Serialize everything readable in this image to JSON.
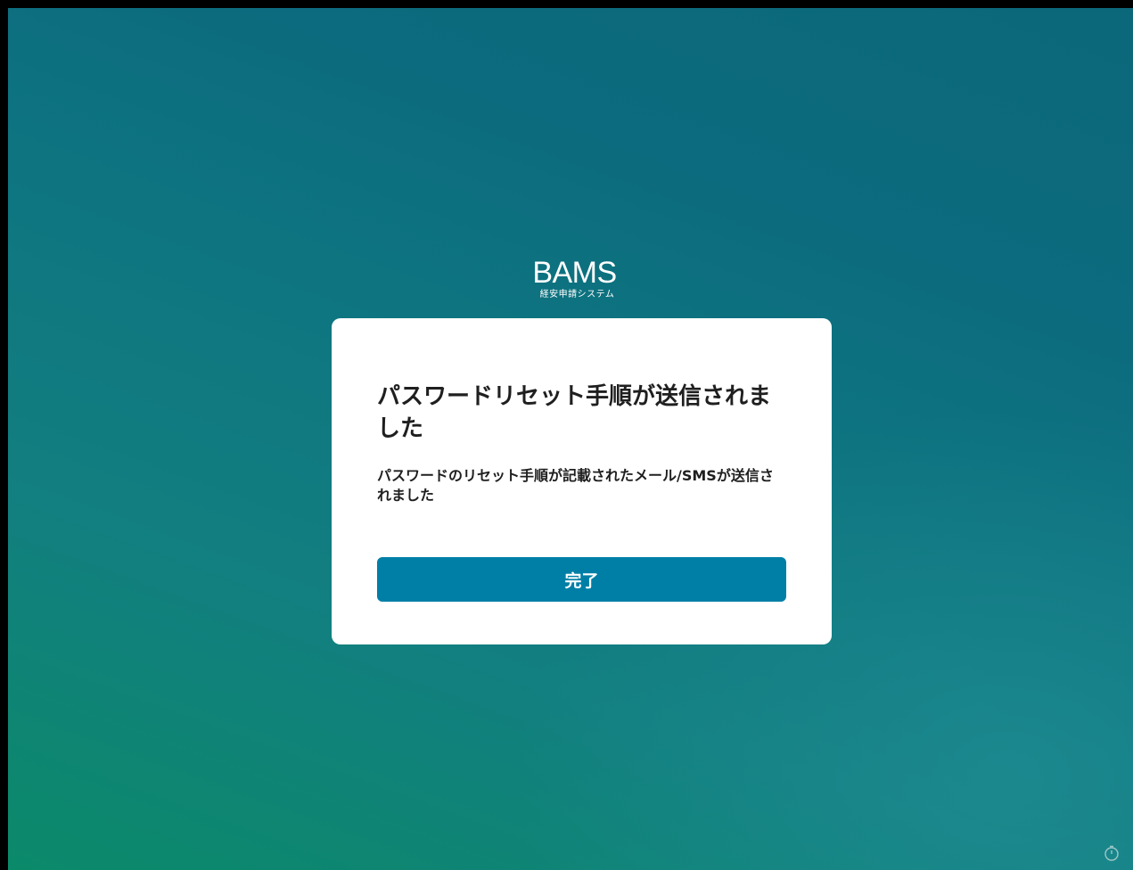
{
  "brand": {
    "name": "BAMS",
    "subtitle": "経安申請システム"
  },
  "dialog": {
    "title": "パスワードリセット手順が送信されました",
    "message": "パスワードのリセット手順が記載されたメール/SMSが送信されました",
    "done_label": "完了"
  },
  "colors": {
    "primary_button": "#007fa6",
    "background_start": "#0b8a6a",
    "background_end": "#0b687a"
  },
  "icons": {
    "corner": "timer-icon"
  }
}
